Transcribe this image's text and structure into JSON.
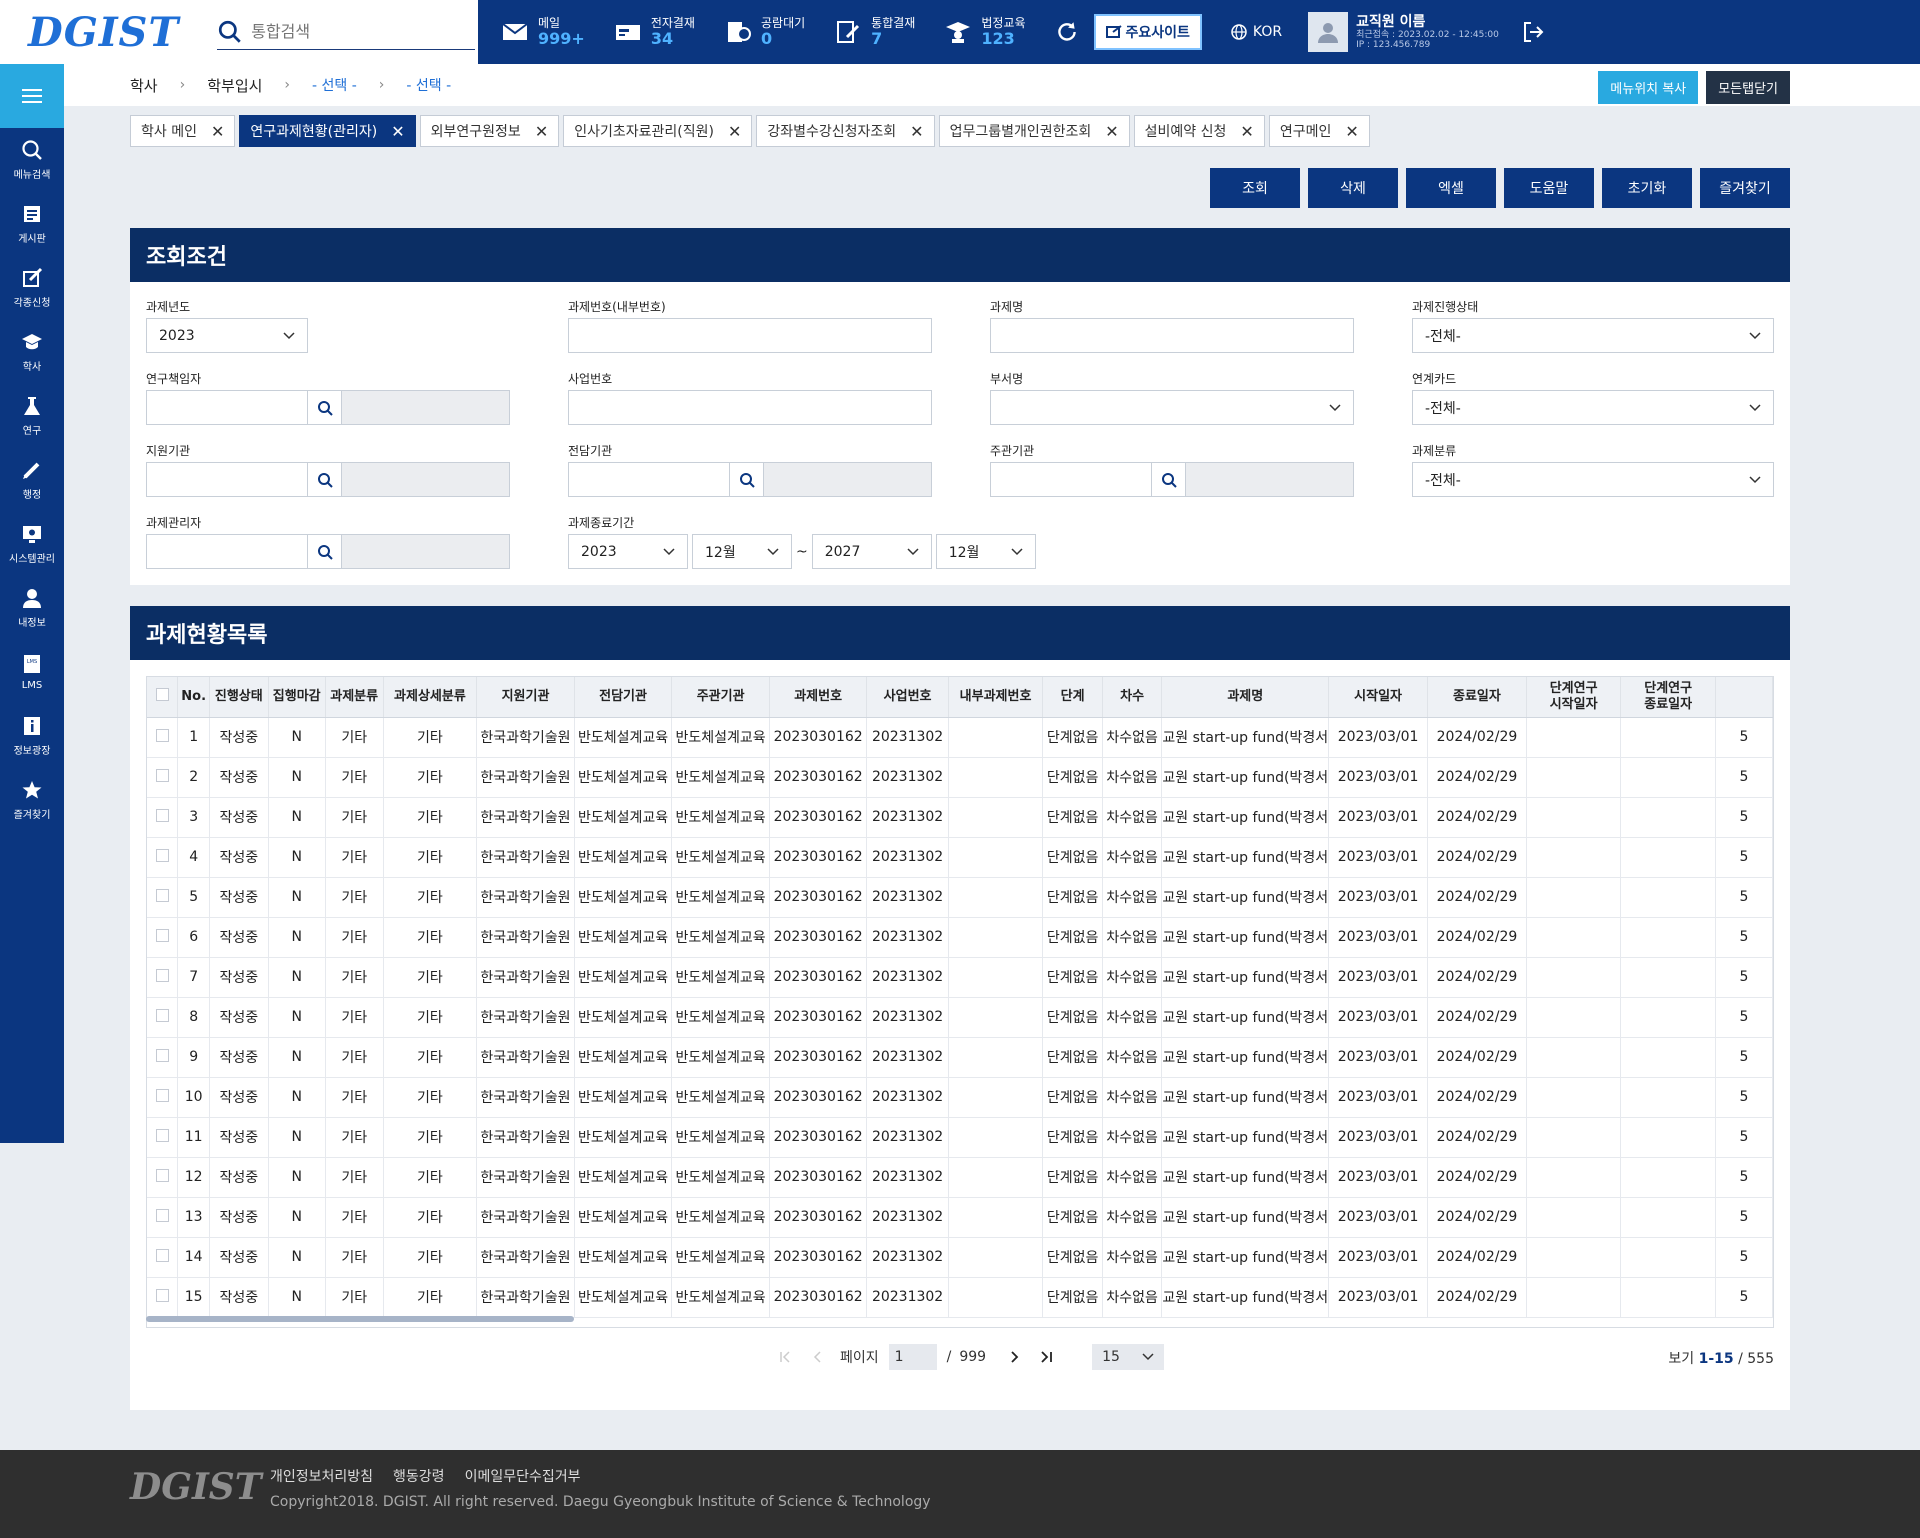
{
  "header": {
    "logo_text": "DGIST",
    "search_placeholder": "통합검색",
    "items": [
      {
        "label": "메일",
        "count": "999+"
      },
      {
        "label": "전자결재",
        "count": "34"
      },
      {
        "label": "공람대기",
        "count": "0"
      },
      {
        "label": "통합결재",
        "count": "7"
      },
      {
        "label": "법정교육",
        "count": "123"
      }
    ],
    "main_site_label": "주요사이트",
    "lang_label": "KOR",
    "user_name": "교직원 이름",
    "last_login": "최근접속 : 2023.02.02 - 12:45:00",
    "ip": "IP : 123.456.789"
  },
  "sidebar": {
    "items": [
      {
        "label": "메뉴검색",
        "icon": "search-icon"
      },
      {
        "label": "게시판",
        "icon": "board-icon"
      },
      {
        "label": "각종신청",
        "icon": "request-icon"
      },
      {
        "label": "학사",
        "icon": "academic-icon"
      },
      {
        "label": "연구",
        "icon": "flask-icon"
      },
      {
        "label": "행정",
        "icon": "pen-icon"
      },
      {
        "label": "시스템관리",
        "icon": "system-icon"
      },
      {
        "label": "내정보",
        "icon": "user-icon"
      },
      {
        "label": "LMS",
        "icon": "lms-icon"
      },
      {
        "label": "정보광장",
        "icon": "info-icon"
      },
      {
        "label": "즐겨찾기",
        "icon": "star-icon"
      }
    ]
  },
  "breadcrumb": {
    "items": [
      "학사",
      "학부입시",
      "- 선택 -",
      "- 선택 -"
    ],
    "copy_button": "메뉴위치 복사",
    "close_all_button": "모든탭닫기"
  },
  "tabs": [
    {
      "label": "학사 메인",
      "active": false
    },
    {
      "label": "연구과제현황(관리자)",
      "active": true
    },
    {
      "label": "외부연구원정보",
      "active": false
    },
    {
      "label": "인사기초자료관리(직원)",
      "active": false
    },
    {
      "label": "강좌별수강신청자조회",
      "active": false
    },
    {
      "label": "업무그룹별개인권한조회",
      "active": false
    },
    {
      "label": "설비예약 신청",
      "active": false
    },
    {
      "label": "연구메인",
      "active": false
    }
  ],
  "actions": [
    "조회",
    "삭제",
    "엑셀",
    "도움말",
    "초기화",
    "즐겨찾기"
  ],
  "search_panel": {
    "title": "조회조건",
    "labels": {
      "year": "과제년도",
      "internal_no": "과제번호(내부번호)",
      "name": "과제명",
      "status": "과제진행상태",
      "pi": "연구책임자",
      "biz_no": "사업번호",
      "dept": "부서명",
      "card": "연계카드",
      "support": "지원기관",
      "agency": "전담기관",
      "host": "주관기관",
      "category": "과제분류",
      "manager": "과제관리자",
      "end_period": "과제종료기간"
    },
    "values": {
      "year": "2023",
      "status": "-전체-",
      "card": "-전체-",
      "category": "-전체-",
      "end_from_year": "2023",
      "end_from_month": "12월",
      "end_to_year": "2027",
      "end_to_month": "12월",
      "tilde": "~"
    }
  },
  "list_panel": {
    "title": "과제현황목록",
    "columns": [
      "No.",
      "진행상태",
      "집행마감",
      "과제분류",
      "과제상세분류",
      "지원기관",
      "전담기관",
      "주관기관",
      "과제번호",
      "사업번호",
      "내부과제번호",
      "단계",
      "차수",
      "과제명",
      "시작일자",
      "종료일자",
      "단계연구\n시작일자",
      "단계연구\n종료일자"
    ],
    "rows": [
      [
        "1",
        "작성중",
        "N",
        "기타",
        "기타",
        "한국과학기술원",
        "반도체설계교육",
        "반도체설계교육",
        "2023030162",
        "20231302",
        "",
        "단계없음",
        "차수없음",
        "교원 start-up fund(박경서",
        "2023/03/01",
        "2024/02/29",
        "",
        "",
        "5"
      ],
      [
        "2",
        "작성중",
        "N",
        "기타",
        "기타",
        "한국과학기술원",
        "반도체설계교육",
        "반도체설계교육",
        "2023030162",
        "20231302",
        "",
        "단계없음",
        "차수없음",
        "교원 start-up fund(박경서",
        "2023/03/01",
        "2024/02/29",
        "",
        "",
        "5"
      ],
      [
        "3",
        "작성중",
        "N",
        "기타",
        "기타",
        "한국과학기술원",
        "반도체설계교육",
        "반도체설계교육",
        "2023030162",
        "20231302",
        "",
        "단계없음",
        "차수없음",
        "교원 start-up fund(박경서",
        "2023/03/01",
        "2024/02/29",
        "",
        "",
        "5"
      ],
      [
        "4",
        "작성중",
        "N",
        "기타",
        "기타",
        "한국과학기술원",
        "반도체설계교육",
        "반도체설계교육",
        "2023030162",
        "20231302",
        "",
        "단계없음",
        "차수없음",
        "교원 start-up fund(박경서",
        "2023/03/01",
        "2024/02/29",
        "",
        "",
        "5"
      ],
      [
        "5",
        "작성중",
        "N",
        "기타",
        "기타",
        "한국과학기술원",
        "반도체설계교육",
        "반도체설계교육",
        "2023030162",
        "20231302",
        "",
        "단계없음",
        "차수없음",
        "교원 start-up fund(박경서",
        "2023/03/01",
        "2024/02/29",
        "",
        "",
        "5"
      ],
      [
        "6",
        "작성중",
        "N",
        "기타",
        "기타",
        "한국과학기술원",
        "반도체설계교육",
        "반도체설계교육",
        "2023030162",
        "20231302",
        "",
        "단계없음",
        "차수없음",
        "교원 start-up fund(박경서",
        "2023/03/01",
        "2024/02/29",
        "",
        "",
        "5"
      ],
      [
        "7",
        "작성중",
        "N",
        "기타",
        "기타",
        "한국과학기술원",
        "반도체설계교육",
        "반도체설계교육",
        "2023030162",
        "20231302",
        "",
        "단계없음",
        "차수없음",
        "교원 start-up fund(박경서",
        "2023/03/01",
        "2024/02/29",
        "",
        "",
        "5"
      ],
      [
        "8",
        "작성중",
        "N",
        "기타",
        "기타",
        "한국과학기술원",
        "반도체설계교육",
        "반도체설계교육",
        "2023030162",
        "20231302",
        "",
        "단계없음",
        "차수없음",
        "교원 start-up fund(박경서",
        "2023/03/01",
        "2024/02/29",
        "",
        "",
        "5"
      ],
      [
        "9",
        "작성중",
        "N",
        "기타",
        "기타",
        "한국과학기술원",
        "반도체설계교육",
        "반도체설계교육",
        "2023030162",
        "20231302",
        "",
        "단계없음",
        "차수없음",
        "교원 start-up fund(박경서",
        "2023/03/01",
        "2024/02/29",
        "",
        "",
        "5"
      ],
      [
        "10",
        "작성중",
        "N",
        "기타",
        "기타",
        "한국과학기술원",
        "반도체설계교육",
        "반도체설계교육",
        "2023030162",
        "20231302",
        "",
        "단계없음",
        "차수없음",
        "교원 start-up fund(박경서",
        "2023/03/01",
        "2024/02/29",
        "",
        "",
        "5"
      ],
      [
        "11",
        "작성중",
        "N",
        "기타",
        "기타",
        "한국과학기술원",
        "반도체설계교육",
        "반도체설계교육",
        "2023030162",
        "20231302",
        "",
        "단계없음",
        "차수없음",
        "교원 start-up fund(박경서",
        "2023/03/01",
        "2024/02/29",
        "",
        "",
        "5"
      ],
      [
        "12",
        "작성중",
        "N",
        "기타",
        "기타",
        "한국과학기술원",
        "반도체설계교육",
        "반도체설계교육",
        "2023030162",
        "20231302",
        "",
        "단계없음",
        "차수없음",
        "교원 start-up fund(박경서",
        "2023/03/01",
        "2024/02/29",
        "",
        "",
        "5"
      ],
      [
        "13",
        "작성중",
        "N",
        "기타",
        "기타",
        "한국과학기술원",
        "반도체설계교육",
        "반도체설계교육",
        "2023030162",
        "20231302",
        "",
        "단계없음",
        "차수없음",
        "교원 start-up fund(박경서",
        "2023/03/01",
        "2024/02/29",
        "",
        "",
        "5"
      ],
      [
        "14",
        "작성중",
        "N",
        "기타",
        "기타",
        "한국과학기술원",
        "반도체설계교육",
        "반도체설계교육",
        "2023030162",
        "20231302",
        "",
        "단계없음",
        "차수없음",
        "교원 start-up fund(박경서",
        "2023/03/01",
        "2024/02/29",
        "",
        "",
        "5"
      ],
      [
        "15",
        "작성중",
        "N",
        "기타",
        "기타",
        "한국과학기술원",
        "반도체설계교육",
        "반도체설계교육",
        "2023030162",
        "20231302",
        "",
        "단계없음",
        "차수없음",
        "교원 start-up fund(박경서",
        "2023/03/01",
        "2024/02/29",
        "",
        "",
        "5"
      ]
    ],
    "pager": {
      "page_label": "페이지",
      "current": "1",
      "sep": "/",
      "total": "999",
      "page_size": "15",
      "view_label": "보기",
      "range": "1-15",
      "view_sep": "/",
      "count": "555"
    }
  },
  "footer": {
    "logo_text": "DGIST",
    "links": [
      "개인정보처리방침",
      "행동강령",
      "이메일무단수집거부"
    ],
    "copyright": "Copyright2018. DGIST. All right reserved. Daegu Gyeongbuk Institute of Science & Technology"
  },
  "colors": {
    "navy": "#0b3680",
    "panel_title": "#0b2e64",
    "accent": "#29a9e0",
    "count": "#4fb2ff"
  }
}
